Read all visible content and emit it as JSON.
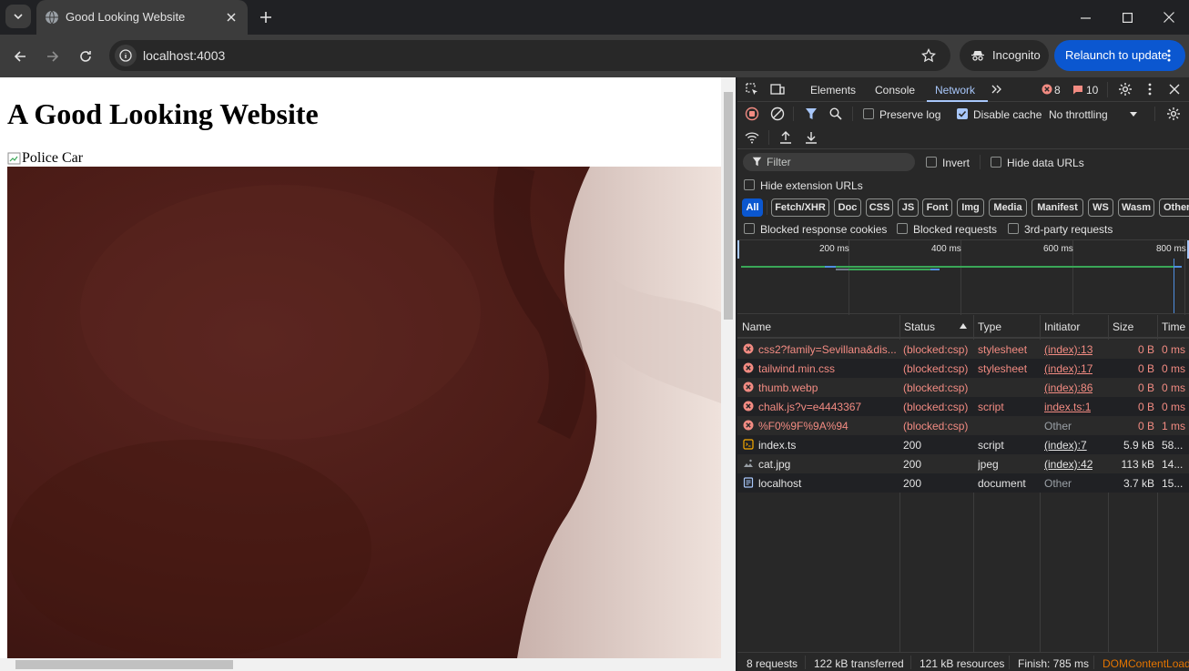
{
  "browser": {
    "tab_title": "Good Looking Website",
    "url": "localhost:4003",
    "incognito_label": "Incognito",
    "relaunch_label": "Relaunch to update"
  },
  "page": {
    "heading": "A Good Looking Website",
    "broken_image_alt": "Police Car"
  },
  "devtools": {
    "tabs": [
      "Elements",
      "Console",
      "Network"
    ],
    "active_tab": "Network",
    "error_count": "8",
    "warning_count": "10",
    "preserve_log": "Preserve log",
    "disable_cache": "Disable cache",
    "throttling": "No throttling",
    "filter_placeholder": "Filter",
    "invert": "Invert",
    "hide_data_urls": "Hide data URLs",
    "hide_extension_urls": "Hide extension URLs",
    "type_filters": [
      "All",
      "Fetch/XHR",
      "Doc",
      "CSS",
      "JS",
      "Font",
      "Img",
      "Media",
      "Manifest",
      "WS",
      "Wasm",
      "Other"
    ],
    "blocked_cookies": "Blocked response cookies",
    "blocked_requests": "Blocked requests",
    "third_party": "3rd-party requests",
    "timeline_ticks": [
      "200 ms",
      "400 ms",
      "600 ms",
      "800 ms"
    ],
    "columns": [
      "Name",
      "Status",
      "Type",
      "Initiator",
      "Size",
      "Time"
    ],
    "rows": [
      {
        "name": "css2?family=Sevillana&dis...",
        "status": "(blocked:csp)",
        "type": "stylesheet",
        "initiator": "(index):13",
        "size": "0 B",
        "time": "0 ms",
        "error": true
      },
      {
        "name": "tailwind.min.css",
        "status": "(blocked:csp)",
        "type": "stylesheet",
        "initiator": "(index):17",
        "size": "0 B",
        "time": "0 ms",
        "error": true
      },
      {
        "name": "thumb.webp",
        "status": "(blocked:csp)",
        "type": "",
        "initiator": "(index):86",
        "size": "0 B",
        "time": "0 ms",
        "error": true
      },
      {
        "name": "chalk.js?v=e4443367",
        "status": "(blocked:csp)",
        "type": "script",
        "initiator": "index.ts:1",
        "size": "0 B",
        "time": "0 ms",
        "error": true
      },
      {
        "name": "%F0%9F%9A%94",
        "status": "(blocked:csp)",
        "type": "",
        "initiator": "Other",
        "size": "0 B",
        "time": "1 ms",
        "error": true
      },
      {
        "name": "index.ts",
        "status": "200",
        "type": "script",
        "initiator": "(index):7",
        "size": "5.9 kB",
        "time": "58...",
        "error": false
      },
      {
        "name": "cat.jpg",
        "status": "200",
        "type": "jpeg",
        "initiator": "(index):42",
        "size": "113 kB",
        "time": "14...",
        "error": false
      },
      {
        "name": "localhost",
        "status": "200",
        "type": "document",
        "initiator": "Other",
        "size": "3.7 kB",
        "time": "15...",
        "error": false
      }
    ],
    "summary": {
      "requests": "8 requests",
      "transferred": "122 kB transferred",
      "resources": "121 kB resources",
      "finish": "Finish: 785 ms",
      "dom": "DOMContentLoad"
    }
  },
  "colors": {
    "accent": "#a8c7fa",
    "error": "#f28b82",
    "relaunch": "#0b57d0"
  }
}
